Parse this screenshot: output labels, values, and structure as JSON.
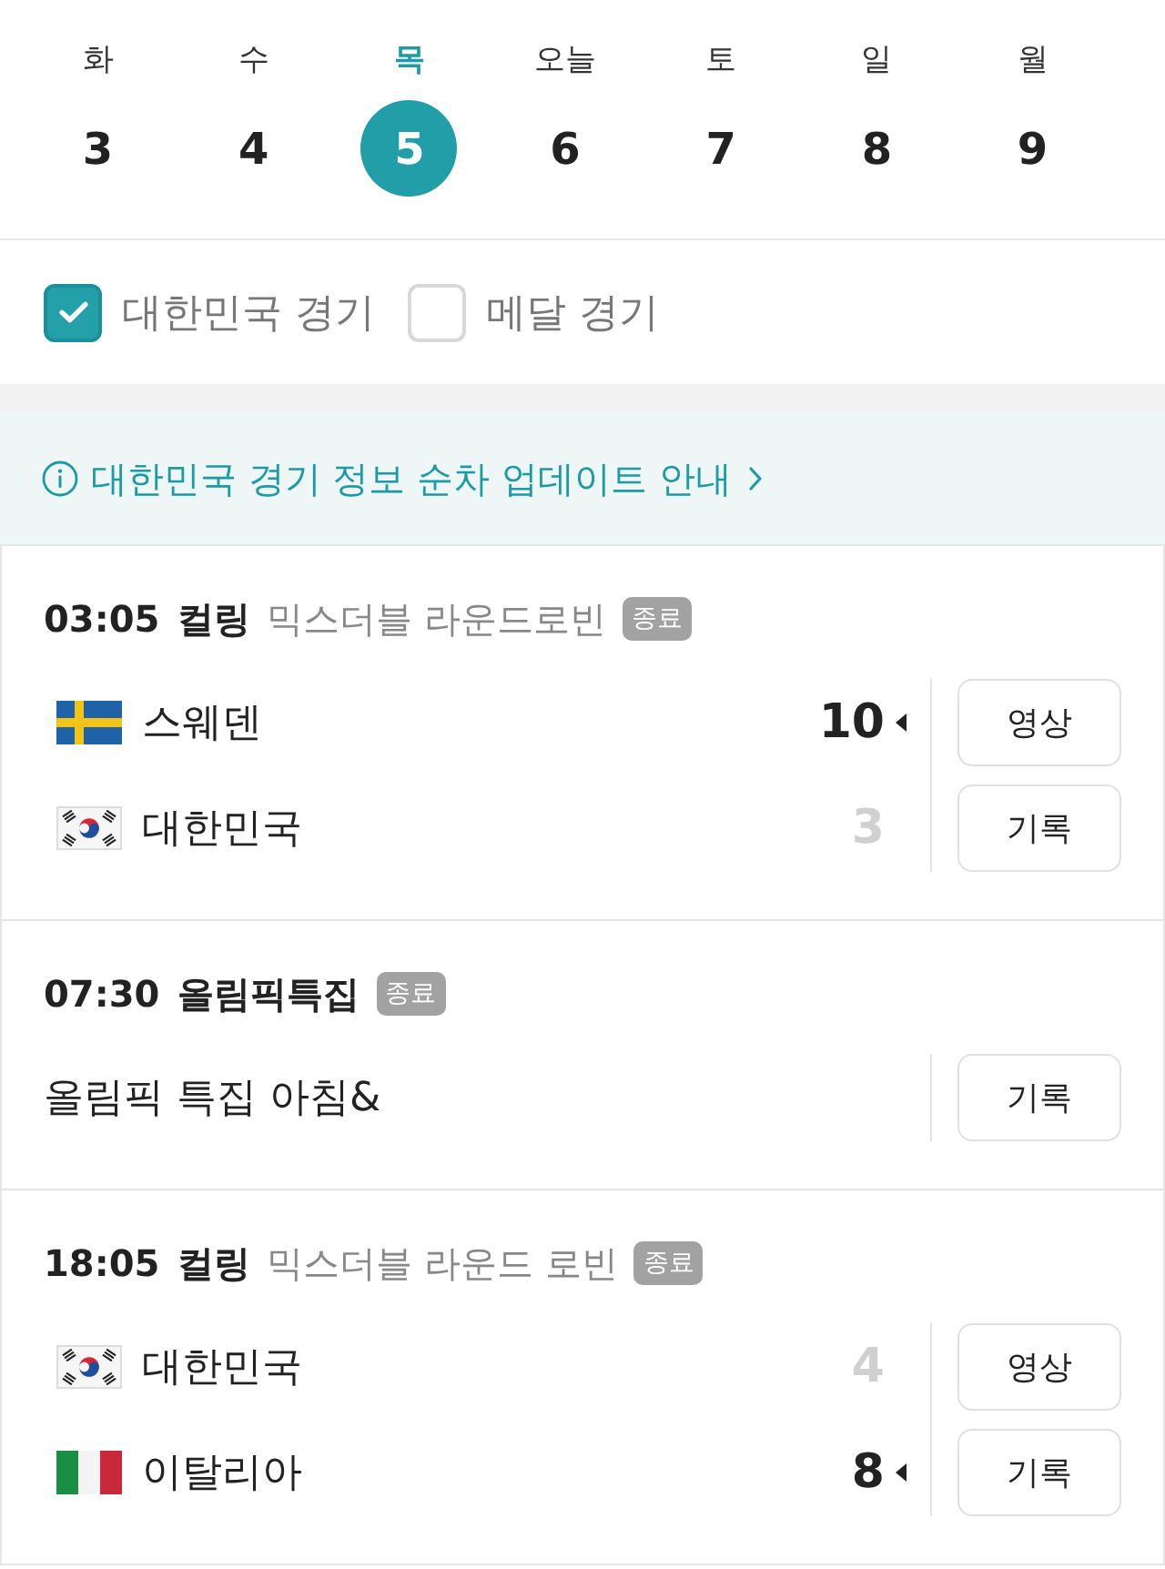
{
  "date_strip": {
    "days": [
      {
        "weekday": "화",
        "date": "3",
        "selected": false
      },
      {
        "weekday": "수",
        "date": "4",
        "selected": false
      },
      {
        "weekday": "목",
        "date": "5",
        "selected": true
      },
      {
        "weekday": "오늘",
        "date": "6",
        "selected": false
      },
      {
        "weekday": "토",
        "date": "7",
        "selected": false
      },
      {
        "weekday": "일",
        "date": "8",
        "selected": false
      },
      {
        "weekday": "월",
        "date": "9",
        "selected": false
      }
    ]
  },
  "filters": [
    {
      "label": "대한민국 경기",
      "checked": true
    },
    {
      "label": "메달 경기",
      "checked": false
    }
  ],
  "notice": {
    "text": "대한민국 경기 정보 순차 업데이트 안내"
  },
  "matches": [
    {
      "kind": "versus",
      "time": "03:05",
      "sport": "컬링",
      "event": "믹스더블 라운드로빈",
      "status": "종료",
      "teams": [
        {
          "kind": "sweden",
          "name": "스웨덴",
          "score": "10",
          "winner": true
        },
        {
          "kind": "korea",
          "name": "대한민국",
          "score": "3",
          "winner": false
        }
      ],
      "buttons": [
        "영상",
        "기록"
      ]
    },
    {
      "kind": "program",
      "time": "07:30",
      "sport": "올림픽특집",
      "status": "종료",
      "title": "올림픽 특집 아침&",
      "buttons": [
        "기록"
      ]
    },
    {
      "kind": "versus",
      "time": "18:05",
      "sport": "컬링",
      "event": "믹스더블 라운드 로빈",
      "status": "종료",
      "teams": [
        {
          "kind": "korea",
          "name": "대한민국",
          "score": "4",
          "winner": false
        },
        {
          "kind": "italy",
          "name": "이탈리아",
          "score": "8",
          "winner": true
        }
      ],
      "buttons": [
        "영상",
        "기록"
      ]
    }
  ]
}
